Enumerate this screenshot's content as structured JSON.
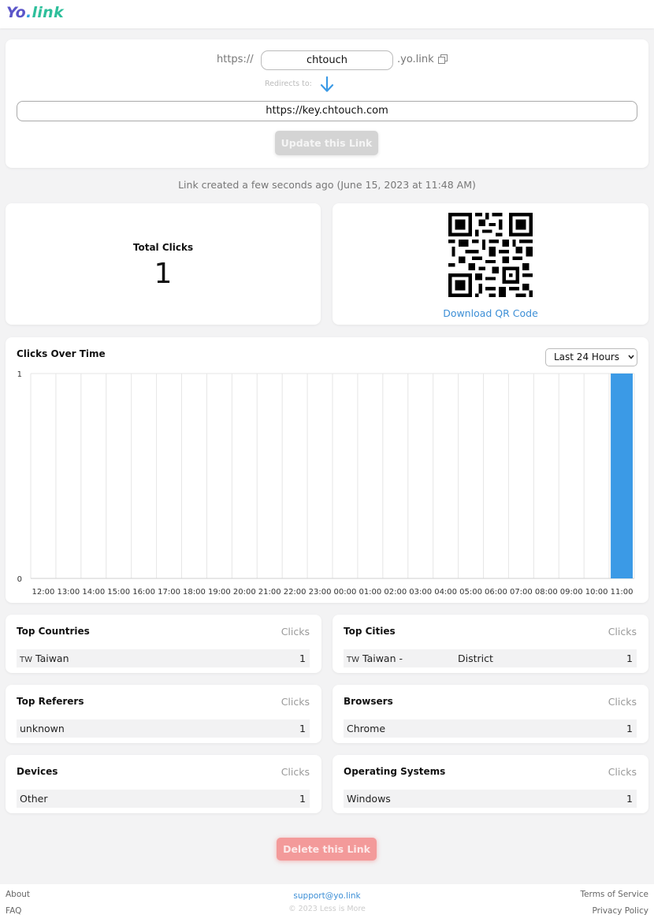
{
  "brand": {
    "logo_part1": "Yo",
    "logo_dot": ".",
    "logo_part2": "link"
  },
  "link_editor": {
    "prefix": "https://",
    "slug": "chtouch",
    "suffix": ".yo.link",
    "redirects_label": "Redirects to:",
    "destination": "https://key.chtouch.com",
    "update_label": "Update this Link"
  },
  "created_text": "Link created a few seconds ago (June 15, 2023 at 11:48 AM)",
  "total": {
    "label": "Total Clicks",
    "value": "1"
  },
  "qr": {
    "download_label": "Download QR Code"
  },
  "chart": {
    "title": "Clicks Over Time",
    "range_selected": "Last 24 Hours",
    "accent": "#3b9ae6"
  },
  "chart_data": {
    "type": "bar",
    "categories": [
      "12:00",
      "13:00",
      "14:00",
      "15:00",
      "16:00",
      "17:00",
      "18:00",
      "19:00",
      "20:00",
      "21:00",
      "22:00",
      "23:00",
      "00:00",
      "01:00",
      "02:00",
      "03:00",
      "04:00",
      "05:00",
      "06:00",
      "07:00",
      "08:00",
      "09:00",
      "10:00",
      "11:00"
    ],
    "values": [
      0,
      0,
      0,
      0,
      0,
      0,
      0,
      0,
      0,
      0,
      0,
      0,
      0,
      0,
      0,
      0,
      0,
      0,
      0,
      0,
      0,
      0,
      0,
      1
    ],
    "ylim": [
      0,
      1
    ],
    "yticks": [
      "0",
      "1"
    ],
    "grid": true
  },
  "stats": {
    "countries": {
      "title": "Top Countries",
      "head": "Clicks",
      "rows": [
        {
          "code": "TW",
          "label": "Taiwan",
          "value": "1"
        }
      ]
    },
    "cities": {
      "title": "Top Cities",
      "head": "Clicks",
      "rows": [
        {
          "code": "TW",
          "label": "Taiwan -",
          "district": "District",
          "value": "1"
        }
      ]
    },
    "referers": {
      "title": "Top Referers",
      "head": "Clicks",
      "rows": [
        {
          "label": "unknown",
          "value": "1"
        }
      ]
    },
    "browsers": {
      "title": "Browsers",
      "head": "Clicks",
      "rows": [
        {
          "label": "Chrome",
          "value": "1"
        }
      ]
    },
    "devices": {
      "title": "Devices",
      "head": "Clicks",
      "rows": [
        {
          "label": "Other",
          "value": "1"
        }
      ]
    },
    "os": {
      "title": "Operating Systems",
      "head": "Clicks",
      "rows": [
        {
          "label": "Windows",
          "value": "1"
        }
      ]
    }
  },
  "delete_label": "Delete this Link",
  "footer": {
    "about": "About",
    "faq": "FAQ",
    "email": "support@yo.link",
    "copyright": "© 2023 Less is More",
    "terms": "Terms of Service",
    "privacy": "Privacy Policy"
  }
}
